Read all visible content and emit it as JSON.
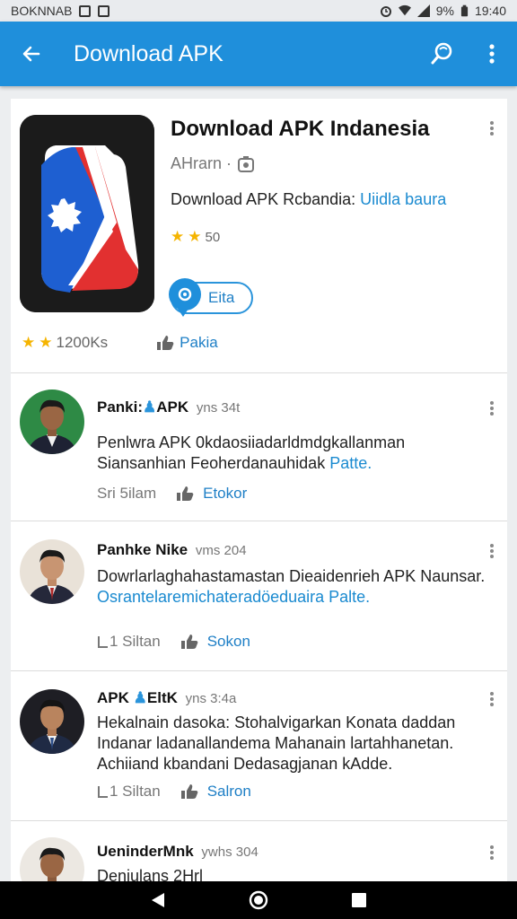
{
  "status_bar": {
    "left_text": "BOKNNAB",
    "battery": "9%",
    "time": "19:40"
  },
  "app_bar": {
    "title": "Download APK",
    "icons": [
      "back-arrow-icon",
      "search-icon",
      "more-vert-icon"
    ]
  },
  "app": {
    "title": "Download APK Indanesia",
    "developer": "AHrarn ·",
    "description": "Download APK Rcbandia:",
    "description_link": "Uiidla baura",
    "rating_value": "50",
    "install_label": "Eita",
    "downloads": "1200Ks",
    "package_label": "Pakia"
  },
  "reviews": [
    {
      "name": "Panki:",
      "name_badge": "APK",
      "time": "yns 34t",
      "text": "Penlwra APK 0kdaosiiadarldmdgkallanman Siansanhian Feoherdanauhidak",
      "link": "Patte.",
      "meta": "Sri 5ilam",
      "reply": "Etokor"
    },
    {
      "name": "Panhke Nike",
      "name_badge": "",
      "time": "vms 204",
      "text": "Dowrlarlaghahastamastan Dieaidenrieh APK Naunsar.",
      "link": "Osrantelaremichateradöeduaira Palte.",
      "meta": "1 Siltan",
      "reply": "Sokon"
    },
    {
      "name": "APK",
      "name_badge": "EltK",
      "time": "yns 3:4a",
      "text": "Hekalnain dasoka: Stohalvigarkan Konata daddan Indanar ladanallandema Mahanain lartahhanetan. Achiiand kbandani Dedasagjanan kAdde.",
      "link": "",
      "meta": "1 Siltan",
      "reply": "Salron"
    },
    {
      "name": "UeninderMnk",
      "name_badge": "",
      "time": "ywhs 304",
      "text": "Deniulans 2Hrl",
      "link": "",
      "meta": "",
      "reply": ""
    }
  ],
  "colors": {
    "app_bar": "#1f8fdb",
    "link": "#1a8ad0",
    "star": "#f5b400"
  }
}
